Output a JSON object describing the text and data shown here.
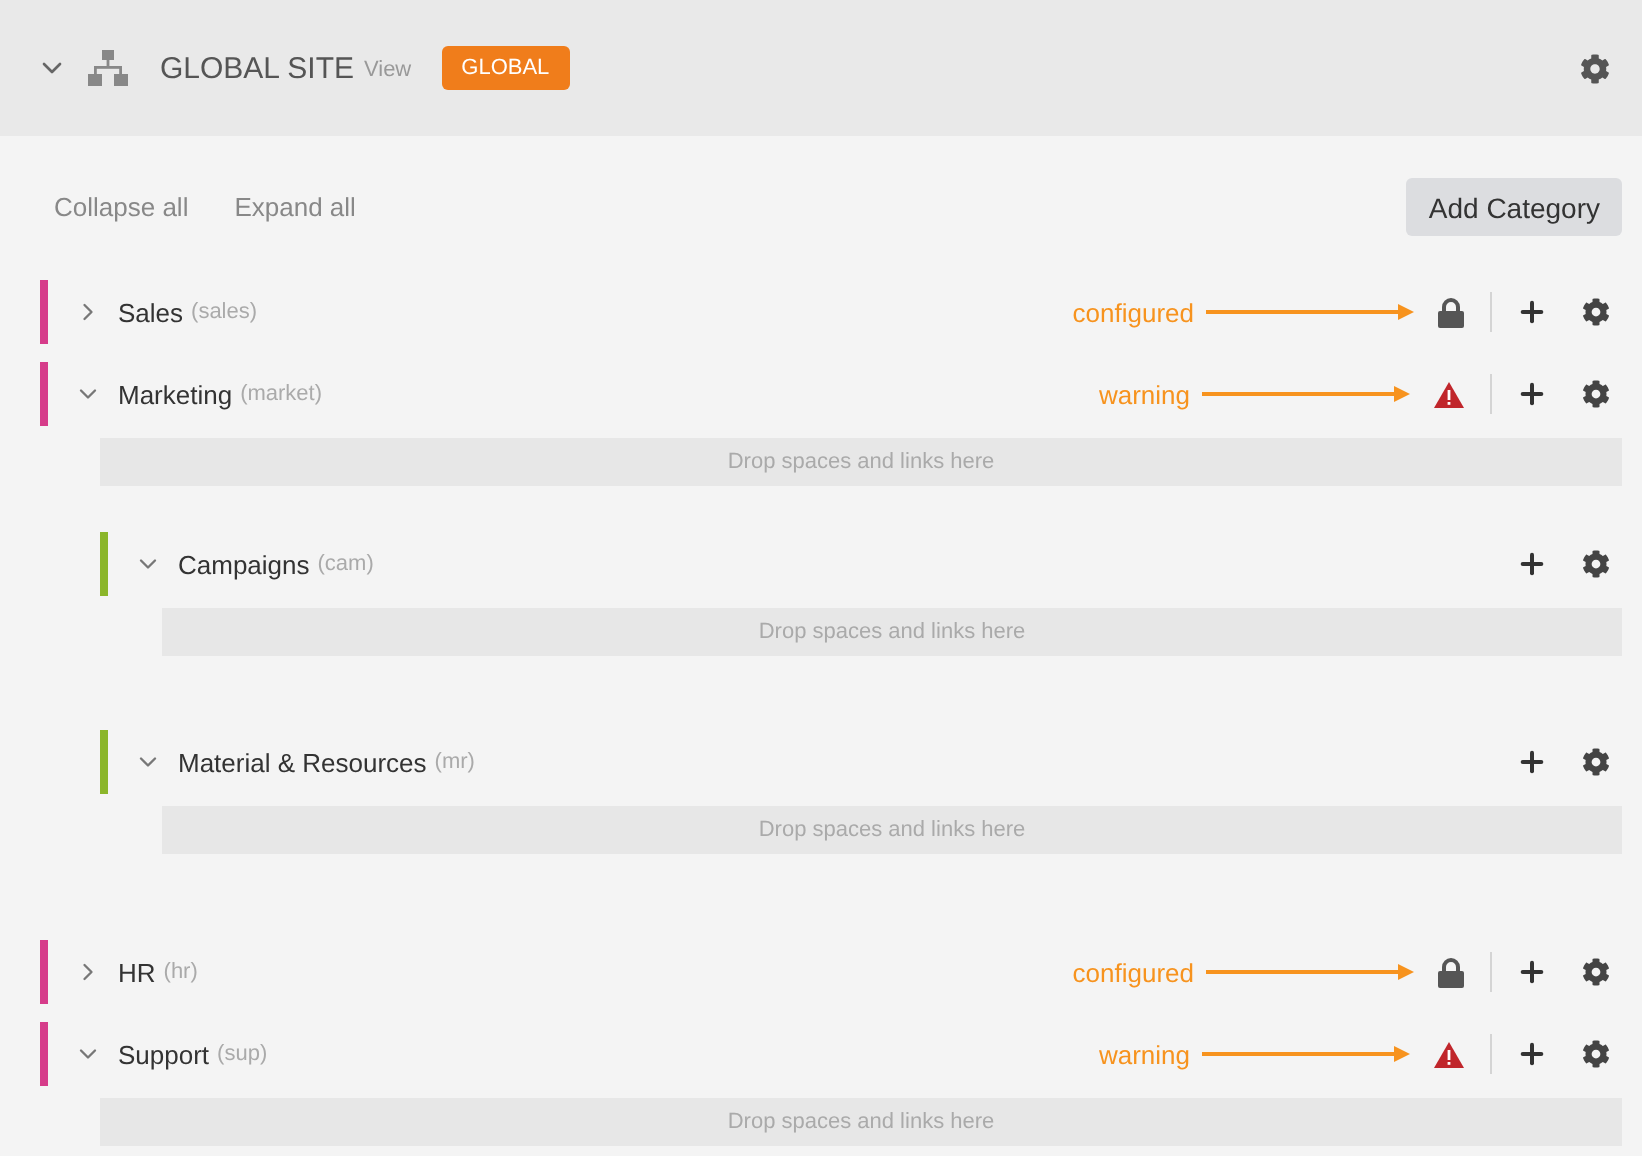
{
  "header": {
    "title": "GLOBAL SITE",
    "view_link": "View",
    "badge": "GLOBAL",
    "expanded": true
  },
  "toolbar": {
    "collapse_all": "Collapse all",
    "expand_all": "Expand all",
    "add_button": "Add Category"
  },
  "categories": [
    {
      "name": "Sales",
      "code": "(sales)",
      "expanded": false,
      "color": "#d63c8a",
      "kind": "locked",
      "annotation": "configured"
    },
    {
      "name": "Marketing",
      "code": "(market)",
      "expanded": true,
      "color": "#d63c8a",
      "kind": "alert",
      "annotation": "warning",
      "drop_zone": "Drop spaces and links here",
      "children": [
        {
          "name": "Campaigns",
          "code": "(cam)",
          "expanded": true,
          "color": "#8bb62a",
          "drop_zone": "Drop spaces and links here"
        },
        {
          "name": "Material & Resources",
          "code": "(mr)",
          "expanded": true,
          "color": "#8bb62a",
          "drop_zone": "Drop spaces and links here"
        }
      ]
    },
    {
      "name": "HR",
      "code": "(hr)",
      "expanded": false,
      "color": "#d63c8a",
      "kind": "locked",
      "annotation": "configured"
    },
    {
      "name": "Support",
      "code": "(sup)",
      "expanded": true,
      "color": "#d63c8a",
      "kind": "alert",
      "annotation": "warning",
      "drop_zone": "Drop spaces and links here"
    }
  ]
}
